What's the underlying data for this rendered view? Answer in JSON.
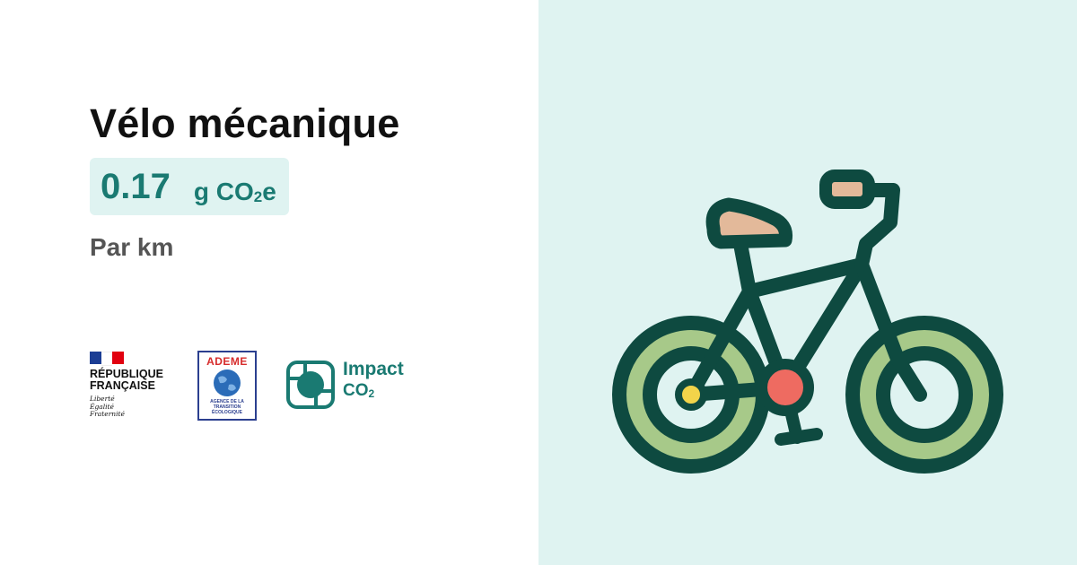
{
  "title": "Vélo mécanique",
  "value": "0.17",
  "unit": {
    "main": "g CO",
    "sub": "2",
    "suffix": "e"
  },
  "per": "Par km",
  "logos": {
    "republique": {
      "line1": "RÉPUBLIQUE",
      "line2": "FRANÇAISE",
      "motto1": "Liberté",
      "motto2": "Égalité",
      "motto3": "Fraternité"
    },
    "ademe": {
      "name": "ADEME",
      "sub1": "AGENCE DE LA",
      "sub2": "TRANSITION",
      "sub3": "ÉCOLOGIQUE"
    },
    "impact": {
      "line1": "Impact",
      "line2": "CO",
      "line2_sub": "2"
    }
  },
  "colors": {
    "accent": "#1a7a72",
    "right_background": "#dff3f1",
    "bike_frame": "#0e4a40",
    "tire": "#a7c989",
    "saddle": "#e3b99a",
    "crank": "#ee6b61",
    "hub": "#f2d44a"
  },
  "illustration": "bicycle-icon"
}
